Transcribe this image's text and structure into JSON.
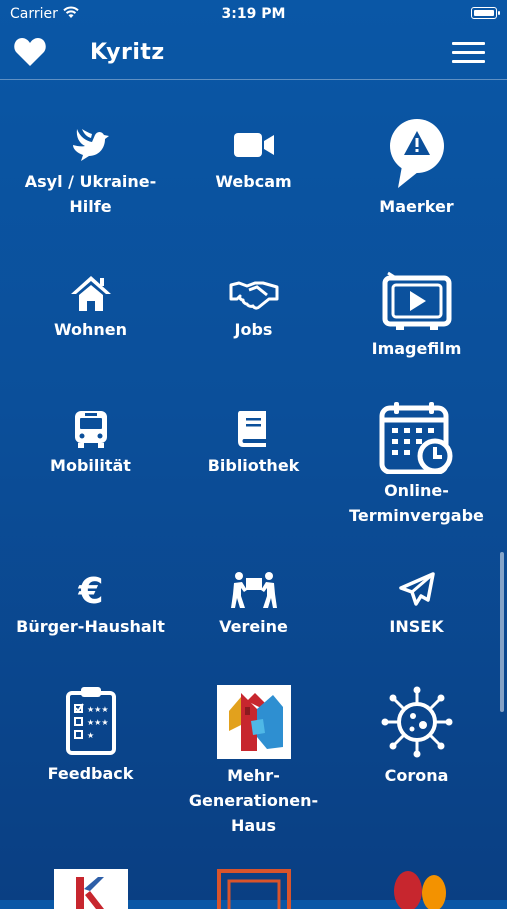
{
  "status": {
    "carrier": "Carrier",
    "time": "3:19 PM"
  },
  "nav": {
    "title": "Kyritz"
  },
  "tiles": [
    {
      "label": "Asyl / Ukraine-\nHilfe",
      "icon": "dove-icon"
    },
    {
      "label": "Webcam",
      "icon": "video-camera-icon"
    },
    {
      "label": "Maerker",
      "icon": "alert-pin-icon"
    },
    {
      "label": "Wohnen",
      "icon": "home-icon"
    },
    {
      "label": "Jobs",
      "icon": "handshake-icon"
    },
    {
      "label": "Imagefilm",
      "icon": "tv-play-icon"
    },
    {
      "label": "Mobilität",
      "icon": "bus-icon"
    },
    {
      "label": "Bibliothek",
      "icon": "book-icon"
    },
    {
      "label": "Online-\nTerminvergabe",
      "icon": "calendar-clock-icon"
    },
    {
      "label": "Bürger-Haushalt",
      "icon": "euro-icon"
    },
    {
      "label": "Vereine",
      "icon": "people-carry-icon"
    },
    {
      "label": "INSEK",
      "icon": "paper-plane-icon"
    },
    {
      "label": "Feedback",
      "icon": "clipboard-icon"
    },
    {
      "label": "Mehr-\nGenerationen-\nHaus",
      "icon": "house-logo-icon"
    },
    {
      "label": "Corona",
      "icon": "virus-icon"
    }
  ]
}
